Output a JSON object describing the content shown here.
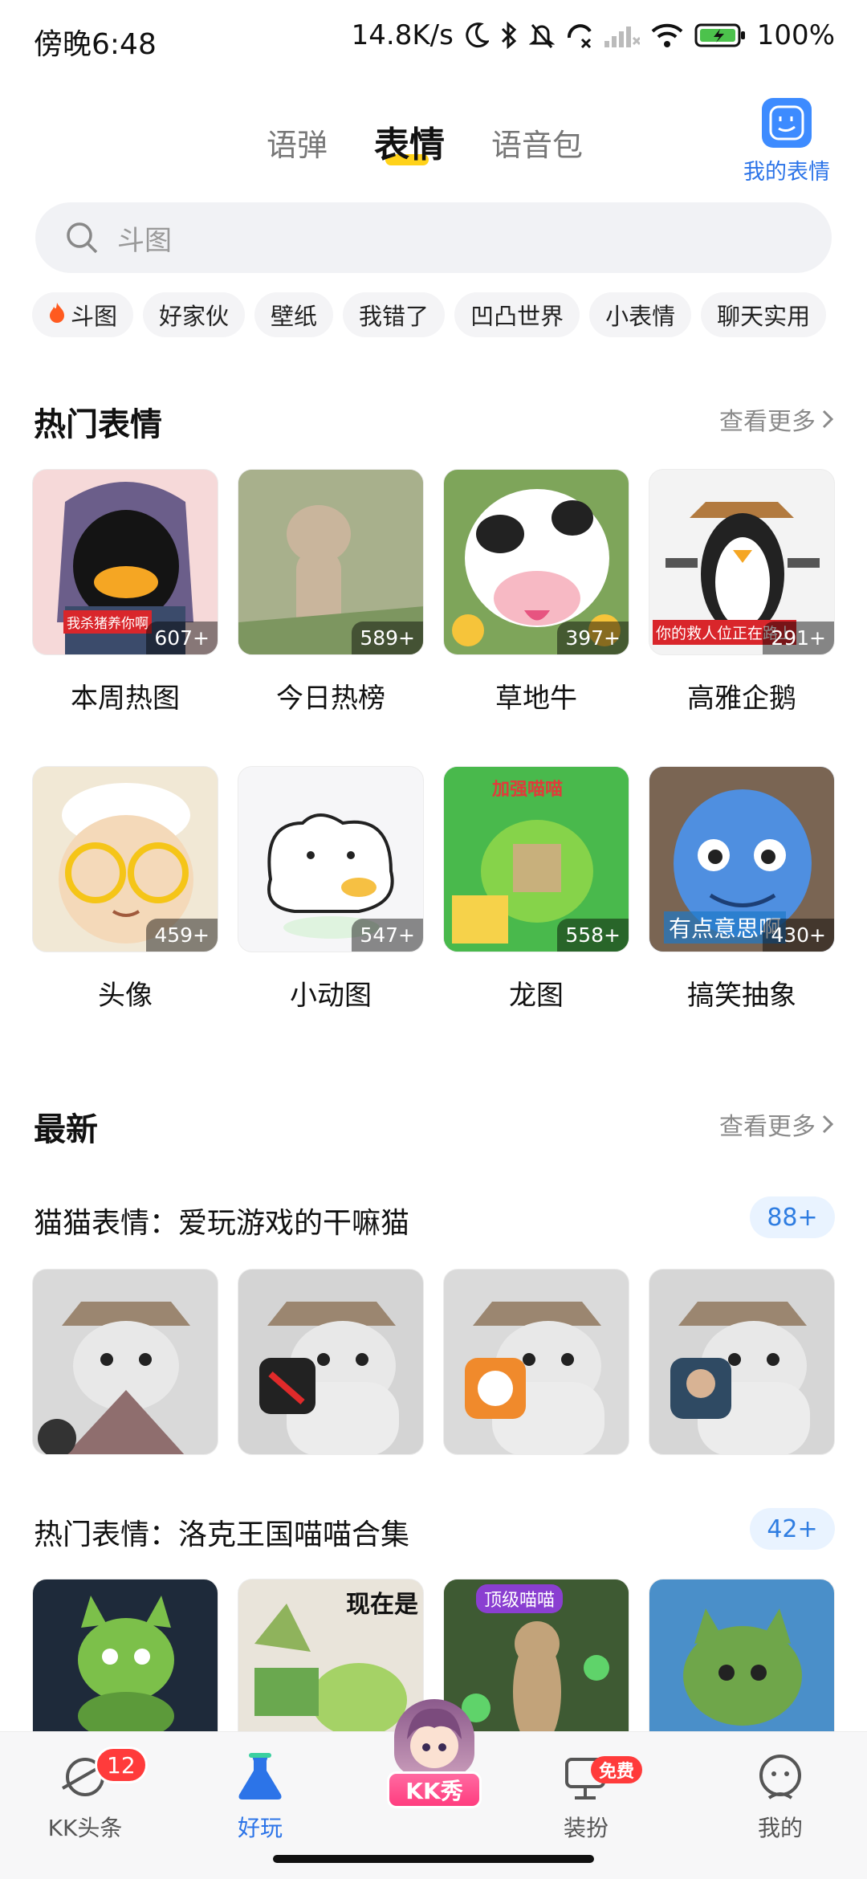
{
  "status_bar": {
    "time": "傍晚6:48",
    "network_speed": "14.8K/s",
    "battery": "100%"
  },
  "top_tabs": [
    {
      "label": "语弹",
      "active": false
    },
    {
      "label": "表情",
      "active": true
    },
    {
      "label": "语音包",
      "active": false
    }
  ],
  "my_emoji": {
    "label": "我的表情",
    "icon": "face-sticker-icon",
    "color": "#3d8bff"
  },
  "search": {
    "placeholder": "斗图"
  },
  "chips": [
    "斗图",
    "好家伙",
    "壁纸",
    "我错了",
    "凹凸世界",
    "小表情",
    "聊天实用"
  ],
  "hot": {
    "title": "热门表情",
    "more": "查看更多",
    "items": [
      {
        "label": "本周热图",
        "count": "607+",
        "caption": "我杀猪养你啊",
        "bg": "#f6d9d9"
      },
      {
        "label": "今日热榜",
        "count": "589+",
        "caption": "",
        "bg": "#9fa88a"
      },
      {
        "label": "草地牛",
        "count": "397+",
        "caption": "",
        "bg": "#7ea55a"
      },
      {
        "label": "高雅企鹅",
        "count": "291+",
        "caption": "你的救人位正在路上",
        "bg": "#f3f3f3"
      },
      {
        "label": "头像",
        "count": "459+",
        "caption": "",
        "bg": "#f1e8d5"
      },
      {
        "label": "小动图",
        "count": "547+",
        "caption": "",
        "bg": "#f6f6f8"
      },
      {
        "label": "龙图",
        "count": "558+",
        "caption": "加强喵喵",
        "bg": "#3fb24a"
      },
      {
        "label": "搞笑抽象",
        "count": "430+",
        "caption": "有点意思啊",
        "bg": "#5e8fd6"
      }
    ]
  },
  "latest": {
    "title": "最新",
    "more": "查看更多",
    "sets": [
      {
        "title": "猫猫表情：爱玩游戏的干嘛猫",
        "count": "88+",
        "thumbs": [
          "#d9d9d9",
          "#d4d4d4",
          "#dadada",
          "#d6d6d6"
        ]
      },
      {
        "title": "热门表情：洛克王国喵喵合集",
        "count": "42+",
        "thumbs": [
          "#1e2a3a",
          "#e9e4da",
          "#4f6b3e",
          "#4a8fc9"
        ],
        "captions": [
          "",
          "现在是",
          "顶级喵喵",
          ""
        ]
      }
    ]
  },
  "bottom_nav": [
    {
      "label": "KK头条",
      "icon": "planet-icon",
      "badge": "12",
      "active": false
    },
    {
      "label": "好玩",
      "icon": "flask-icon",
      "active": true
    },
    {
      "label": "KK秀",
      "icon": "avatar-icon",
      "active": false
    },
    {
      "label": "装扮",
      "icon": "dress-icon",
      "badge": "免费",
      "active": false
    },
    {
      "label": "我的",
      "icon": "profile-icon",
      "active": false
    }
  ],
  "colors": {
    "accent": "#2c74e8",
    "tab_underline": "#ffd21a",
    "badge": "#ff3b3b"
  }
}
